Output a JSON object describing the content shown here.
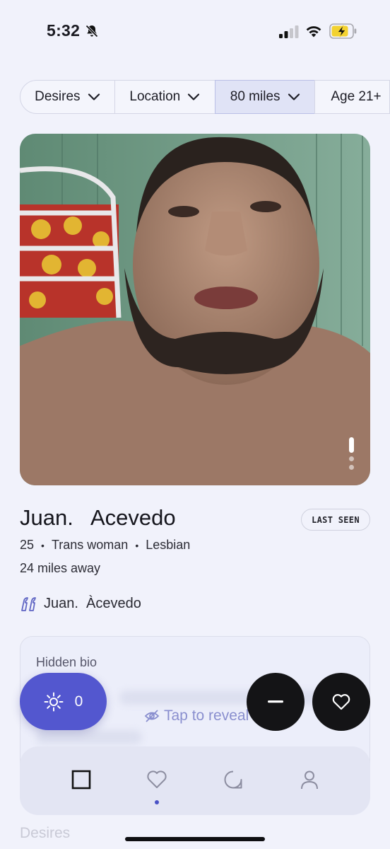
{
  "status_bar": {
    "time": "5:32",
    "icons": [
      "bell-slash-icon",
      "cellular-signal-icon",
      "wifi-icon",
      "battery-charging-icon"
    ]
  },
  "filters": [
    {
      "label": "Desires",
      "icon": "chevron-down-icon",
      "active": false
    },
    {
      "label": "Location",
      "icon": "chevron-down-icon",
      "active": false
    },
    {
      "label": "80 miles",
      "icon": "chevron-down-icon",
      "active": true
    },
    {
      "label": "Age 21+",
      "active": false
    }
  ],
  "photo": {
    "description_icon": "profile-photo",
    "count": 3,
    "current": 1
  },
  "profile": {
    "name": "Juan.   Acevedo",
    "last_seen_badge": "LAST SEEN",
    "age": "25",
    "gender": "Trans woman",
    "orientation": "Lesbian",
    "distance": "24 miles away",
    "quote": "Juan.  Àcevedo",
    "quote_icon": "quote-icon"
  },
  "bio": {
    "title": "Hidden bio",
    "reveal_label": "Tap to reveal",
    "reveal_icon": "eye-slash-icon"
  },
  "next_section": "Desires",
  "actions": {
    "boost_count": "0",
    "boost_icon": "sun-icon",
    "pass_icon": "minus-icon",
    "like_icon": "heart-icon"
  },
  "tabs": [
    {
      "name": "home",
      "icon": "square-icon",
      "active": true
    },
    {
      "name": "likes",
      "icon": "heart-outline-icon",
      "active": false,
      "indicator": true
    },
    {
      "name": "chats",
      "icon": "chat-bubble-icon",
      "active": false
    },
    {
      "name": "profile",
      "icon": "person-icon",
      "active": false
    }
  ],
  "colors": {
    "background": "#f1f2fb",
    "accent": "#5357cf",
    "button_dark": "#141416",
    "reveal_text": "#8a8fcf"
  }
}
